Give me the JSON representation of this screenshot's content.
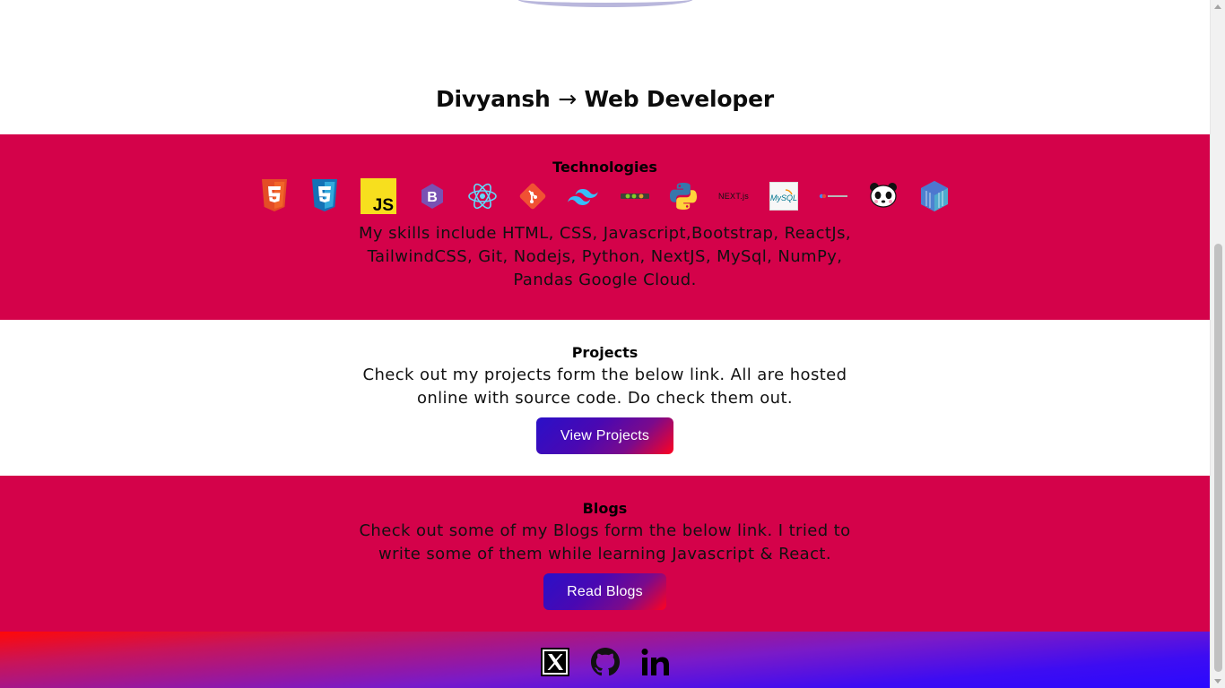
{
  "hero": {
    "name": "Divyansh",
    "arrow": "→",
    "role": "Web Developer"
  },
  "technologies": {
    "heading": "Technologies",
    "icons": [
      "html5-icon",
      "css3-icon",
      "javascript-icon",
      "bootstrap-icon",
      "react-icon",
      "git-icon",
      "tailwindcss-icon",
      "nodejs-icon",
      "python-icon",
      "nextjs-icon",
      "mysql-icon",
      "google-cloud-icon",
      "pandas-icon",
      "numpy-icon"
    ],
    "nextjs_label": "NEXT.js",
    "description": "My skills include HTML, CSS, Javascript,Bootstrap, ReactJs, TailwindCSS, Git, Nodejs, Python, NextJS, MySql, NumPy, Pandas Google Cloud."
  },
  "projects": {
    "heading": "Projects",
    "description": "Check out my projects form the below link. All are hosted online with source code. Do check them out.",
    "button_label": "View Projects"
  },
  "blogs": {
    "heading": "Blogs",
    "description": "Check out some of my Blogs form the below link. I tried to write some of them while learning Javascript & React.",
    "button_label": "Read Blogs"
  },
  "footer": {
    "links": [
      "x-twitter-icon",
      "github-icon",
      "linkedin-icon"
    ]
  },
  "colors": {
    "section_red": "#d4024a",
    "button_gradient_start": "#2a10c8",
    "button_gradient_end": "#ff0220"
  }
}
